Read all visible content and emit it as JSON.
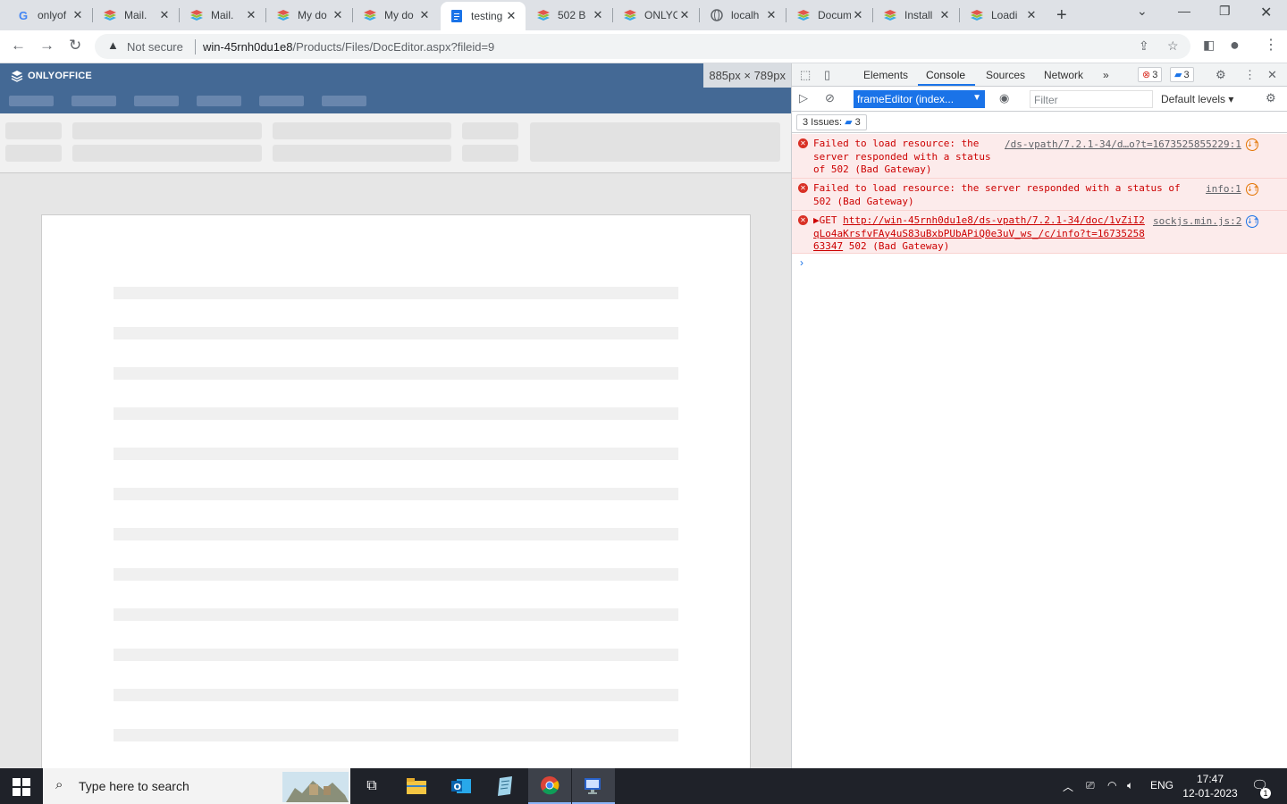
{
  "browser": {
    "tabs": [
      {
        "label": "onlyof",
        "icon": "google-icon"
      },
      {
        "label": "Mail.",
        "icon": "onlyoffice-icon"
      },
      {
        "label": "Mail.",
        "icon": "onlyoffice-icon"
      },
      {
        "label": "My do",
        "icon": "onlyoffice-icon"
      },
      {
        "label": "My do",
        "icon": "onlyoffice-icon"
      },
      {
        "label": "testing",
        "icon": "document-icon",
        "active": true
      },
      {
        "label": "502 B",
        "icon": "onlyoffice-icon"
      },
      {
        "label": "ONLYO",
        "icon": "onlyoffice-icon"
      },
      {
        "label": "localh",
        "icon": "globe-icon"
      },
      {
        "label": "Docum",
        "icon": "onlyoffice-icon"
      },
      {
        "label": "Install",
        "icon": "onlyoffice-icon"
      },
      {
        "label": "Loadi",
        "icon": "onlyoffice-icon"
      }
    ],
    "not_secure": "Not secure",
    "url_host": "win-45rnh0du1e8",
    "url_path": "/Products/Files/DocEditor.aspx?fileid=9"
  },
  "editor": {
    "logo": "ONLYOFFICE",
    "viewport_size": "885px × 789px"
  },
  "devtools": {
    "tabs": [
      "Elements",
      "Console",
      "Sources",
      "Network"
    ],
    "active_tab": "Console",
    "error_count": "3",
    "message_count": "3",
    "context": "frameEditor (index...",
    "filter_placeholder": "Filter",
    "levels": "Default levels ▾",
    "issues_label": "3 Issues:",
    "issues_count": "3",
    "messages": [
      {
        "lines": [
          "Failed to load resource: the",
          "server responded with a status",
          "of 502 (Bad Gateway)"
        ],
        "source": "/ds-vpath/7.2.1-34/d…o?t=1673525855229:1"
      },
      {
        "lines": [
          "Failed to load resource: the server responded with a status of",
          "502 (Bad Gateway)"
        ],
        "source": "info:1"
      },
      {
        "prefix": "▶GET ",
        "url_lines": [
          "http://win-45rnh0du1e8/ds-vpath/7.2.1-34/doc/1vZiI2",
          "qLo4aKrsfvFAy4uS83uBxbPUbAPiQ0e3uV_ws_/c/info?t=16735258",
          "63347"
        ],
        "suffix": " 502 (Bad Gateway)",
        "source": "sockjs.min.js:2"
      }
    ]
  },
  "taskbar": {
    "search_placeholder": "Type here to search",
    "language": "ENG",
    "time": "17:47",
    "date": "12-01-2023",
    "notification_count": "1"
  }
}
